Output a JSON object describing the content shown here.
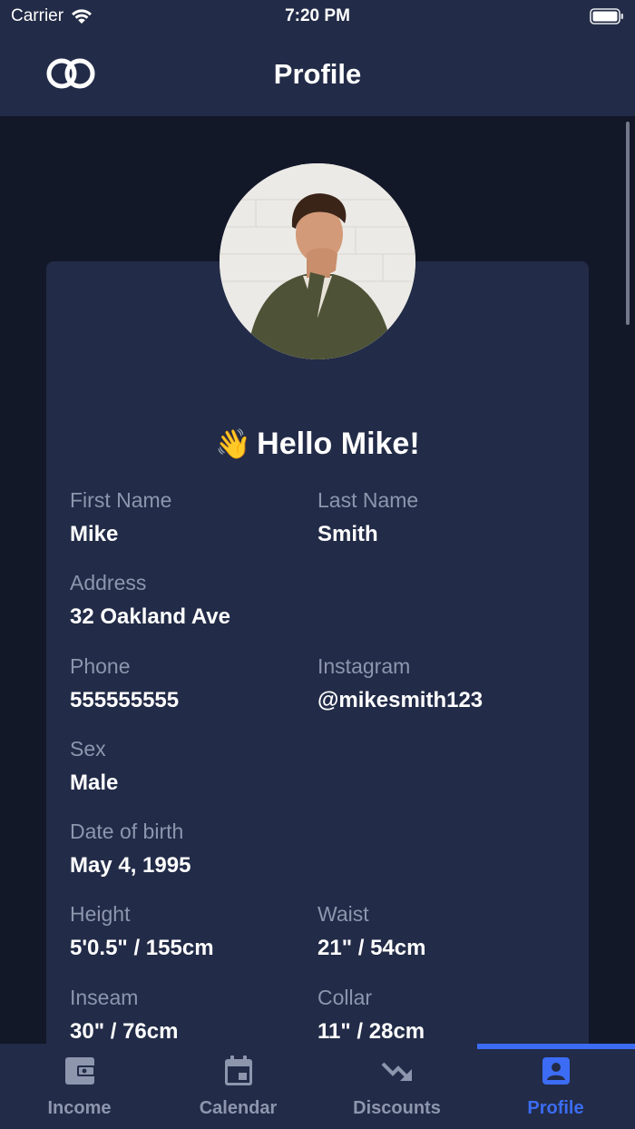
{
  "status_bar": {
    "carrier": "Carrier",
    "time": "7:20 PM"
  },
  "nav": {
    "title": "Profile",
    "logo_icon": "linked-rings-icon"
  },
  "profile": {
    "greeting_emoji": "👋",
    "greeting": "Hello Mike!",
    "fields": {
      "first_name": {
        "label": "First Name",
        "value": "Mike"
      },
      "last_name": {
        "label": "Last Name",
        "value": "Smith"
      },
      "address": {
        "label": "Address",
        "value": "32 Oakland Ave"
      },
      "phone": {
        "label": "Phone",
        "value": "555555555"
      },
      "instagram": {
        "label": "Instagram",
        "value": "@mikesmith123"
      },
      "sex": {
        "label": "Sex",
        "value": "Male"
      },
      "dob": {
        "label": "Date of birth",
        "value": "May 4, 1995"
      },
      "height": {
        "label": "Height",
        "value": "5'0.5\" / 155cm"
      },
      "waist": {
        "label": "Waist",
        "value": "21\" / 54cm"
      },
      "inseam": {
        "label": "Inseam",
        "value": "30\" / 76cm"
      },
      "collar": {
        "label": "Collar",
        "value": "11\" / 28cm"
      }
    }
  },
  "tabs": [
    {
      "label": "Income",
      "icon": "wallet-icon",
      "active": false
    },
    {
      "label": "Calendar",
      "icon": "calendar-icon",
      "active": false
    },
    {
      "label": "Discounts",
      "icon": "trending-down-icon",
      "active": false
    },
    {
      "label": "Profile",
      "icon": "account-box-icon",
      "active": true
    }
  ],
  "colors": {
    "background": "#131829",
    "surface": "#222b47",
    "accent": "#3b6cf3",
    "muted_text": "#8e96ae"
  }
}
